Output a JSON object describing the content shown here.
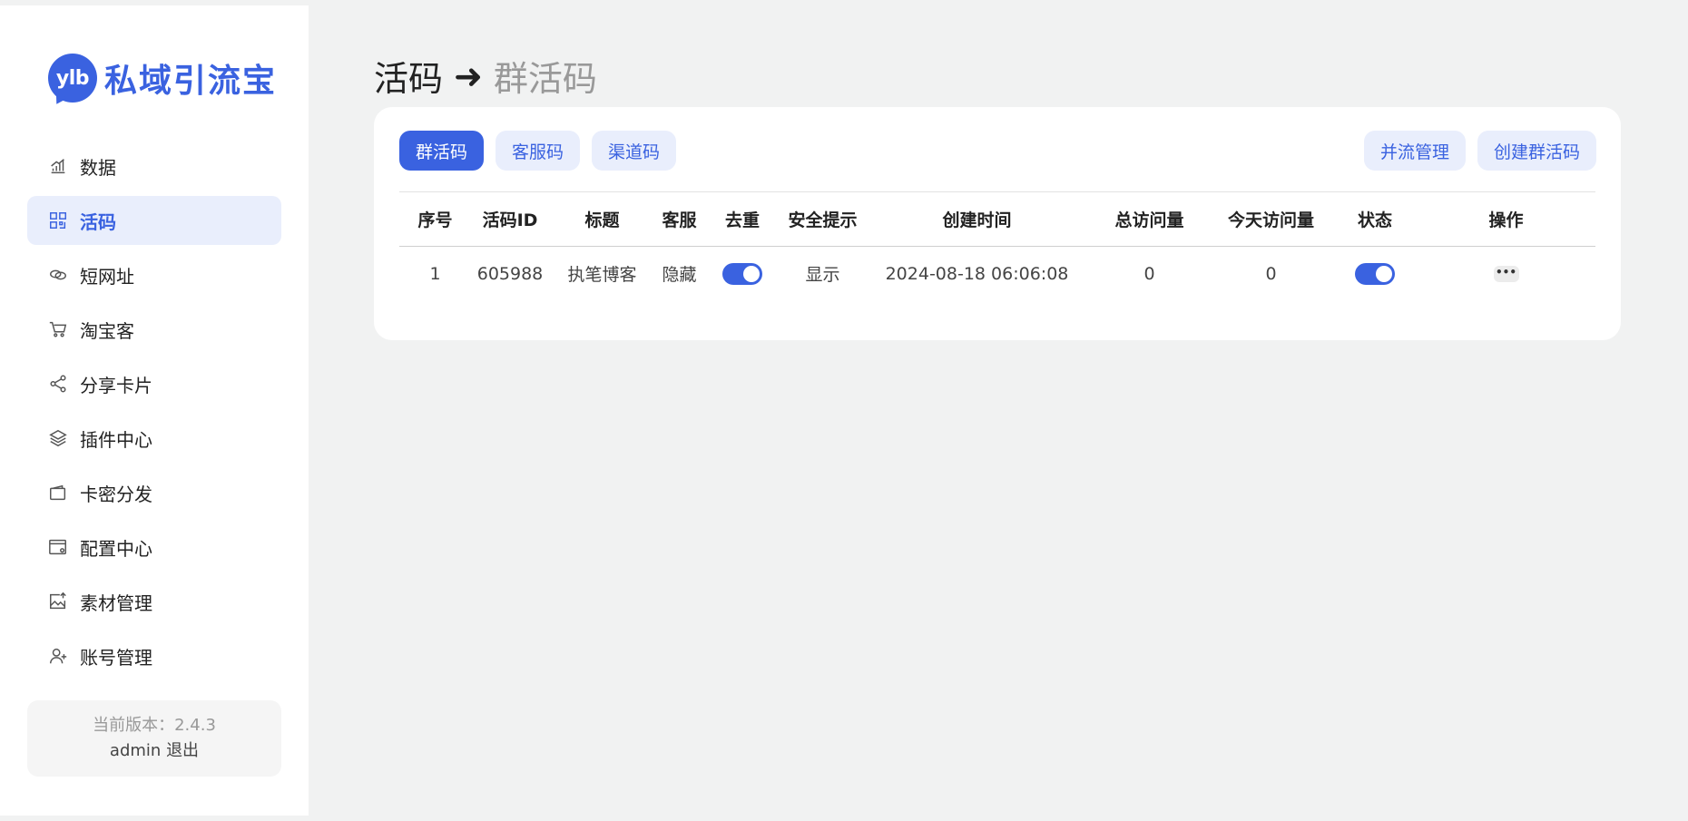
{
  "brand": {
    "badge_text": "ylb",
    "name": "私域引流宝",
    "accent_color": "#3a62e0"
  },
  "sidebar": {
    "items": [
      {
        "label": "数据",
        "icon": "bar-chart-icon",
        "active": false
      },
      {
        "label": "活码",
        "icon": "qrcode-grid-icon",
        "active": true
      },
      {
        "label": "短网址",
        "icon": "link-icon",
        "active": false
      },
      {
        "label": "淘宝客",
        "icon": "shopping-cart-icon",
        "active": false
      },
      {
        "label": "分享卡片",
        "icon": "share-icon",
        "active": false
      },
      {
        "label": "插件中心",
        "icon": "layers-icon",
        "active": false
      },
      {
        "label": "卡密分发",
        "icon": "wallet-icon",
        "active": false
      },
      {
        "label": "配置中心",
        "icon": "settings-window-icon",
        "active": false
      },
      {
        "label": "素材管理",
        "icon": "image-upload-icon",
        "active": false
      },
      {
        "label": "账号管理",
        "icon": "user-icon",
        "active": false
      }
    ],
    "version_text": "当前版本：2.4.3",
    "username": "admin",
    "logout_label": "退出"
  },
  "header": {
    "title": "活码",
    "arrow": "➜",
    "subtitle": "群活码"
  },
  "toolbar": {
    "tabs": [
      {
        "label": "群活码",
        "active": true
      },
      {
        "label": "客服码",
        "active": false
      },
      {
        "label": "渠道码",
        "active": false
      }
    ],
    "merge_label": "并流管理",
    "create_label": "创建群活码"
  },
  "table": {
    "columns": [
      "序号",
      "活码ID",
      "标题",
      "客服",
      "去重",
      "安全提示",
      "创建时间",
      "总访问量",
      "今天访问量",
      "状态",
      "操作"
    ],
    "rows": [
      {
        "index": "1",
        "id": "605988",
        "title": "执笔博客",
        "service": "隐藏",
        "dedupe_on": true,
        "safety": "显示",
        "created": "2024-08-18 06:06:08",
        "total_visits": "0",
        "today_visits": "0",
        "status_on": true,
        "more": "•••"
      }
    ]
  }
}
